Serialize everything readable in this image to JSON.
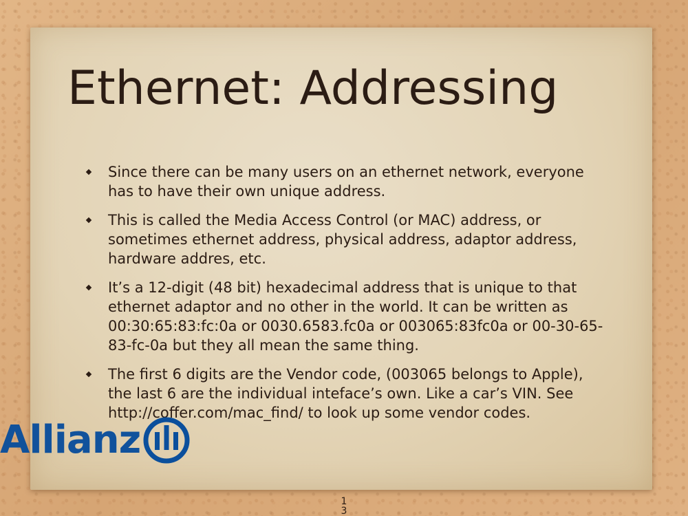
{
  "slide": {
    "title": "Ethernet: Addressing",
    "bullets": [
      "Since there can be many users on an ethernet network, everyone has to have their own unique address.",
      "This is called the Media Access Control (or MAC) address, or sometimes ethernet address, physical address, adaptor address, hardware addres, etc.",
      "It’s a 12-digit (48 bit) hexadecimal address that is unique to that ethernet adaptor and no other in the world. It can be written as 00:30:65:83:fc:0a or 0030.6583.fc0a or 003065:83fc0a or 00-30-65-83-fc-0a but they all mean the same thing.",
      "The first 6 digits are the Vendor code, (003065 belongs to Apple), the last 6 are the individual inteface’s own. Like a car’s VIN. See http://coffer.com/mac_find/ to look up some vendor codes."
    ],
    "page_number": "13"
  },
  "logo": {
    "text": "Allianz",
    "color": "#0b4f9c",
    "icon": "allianz-eagle-icon"
  },
  "colors": {
    "background": "#dcae7f",
    "paper": "#e3d4b6",
    "text": "#2b1c14"
  }
}
